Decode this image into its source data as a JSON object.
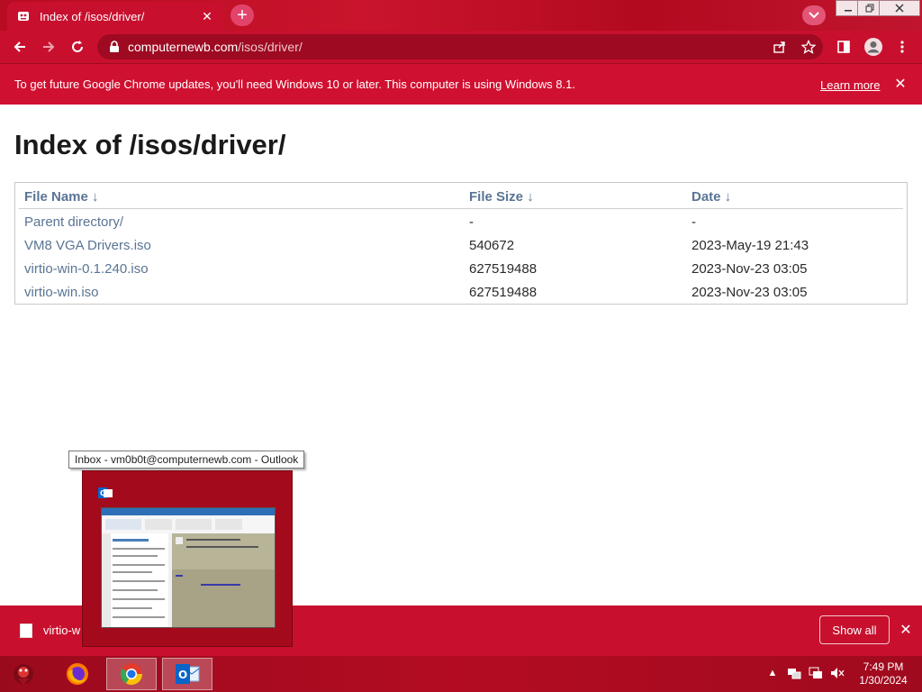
{
  "browser": {
    "tab_title": "Index of /isos/driver/",
    "url_host": "computernewb.com",
    "url_path": "/isos/driver/"
  },
  "infobar": {
    "message": "To get future Google Chrome updates, you'll need Windows 10 or later. This computer is using Windows 8.1.",
    "learn_more": "Learn more"
  },
  "page": {
    "title": "Index of /isos/driver/",
    "columns": {
      "name": "File Name  ↓",
      "size": "File Size  ↓",
      "date": "Date  ↓"
    },
    "rows": [
      {
        "name": "Parent directory/",
        "size": "-",
        "date": "-"
      },
      {
        "name": "VM8 VGA Drivers.iso",
        "size": "540672",
        "date": "2023-May-19 21:43"
      },
      {
        "name": "virtio-win-0.1.240.iso",
        "size": "627519488",
        "date": "2023-Nov-23 03:05"
      },
      {
        "name": "virtio-win.iso",
        "size": "627519488",
        "date": "2023-Nov-23 03:05"
      }
    ]
  },
  "preview": {
    "tooltip": "Inbox - vm0b0t@computernewb.com - Outlook"
  },
  "downloads": {
    "filename": "virtio-w",
    "show_all": "Show all"
  },
  "taskbar": {
    "time": "7:49 PM",
    "date": "1/30/2024"
  },
  "colors": {
    "accent": "#c8102e",
    "link": "#5a7494"
  }
}
